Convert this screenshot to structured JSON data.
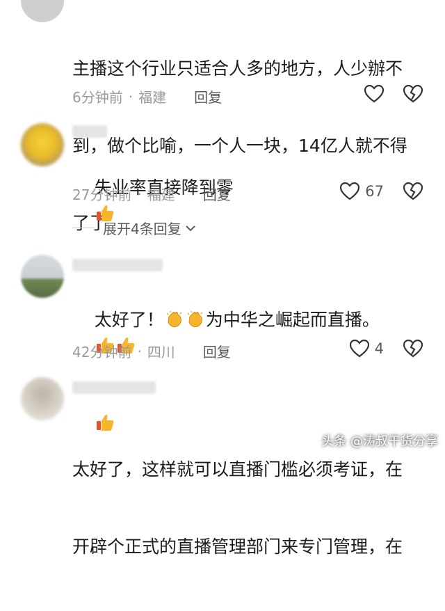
{
  "comments": [
    {
      "text_lines": [
        "主播这个行业只适合人多的地方，人少辦不",
        "到，做个比喻，一个人一块，14亿人就不得",
        "了了"
      ],
      "time": "6分钟前",
      "location": "福建",
      "reply_label": "回复",
      "likes": ""
    },
    {
      "text": "失业率直接降到零",
      "time": "27分钟前",
      "location": "福建",
      "reply_label": "回复",
      "likes": "67"
    },
    {
      "text_a": "太好了！",
      "text_b": "为中华之崛起而直播。",
      "time": "42分钟前",
      "location": "四川",
      "reply_label": "回复",
      "likes": "4"
    },
    {
      "text_lines": [
        "太好了，这样就可以直播门槛必须考证，在",
        "开辟个正式的直播管理部门来专门管理，在"
      ]
    }
  ],
  "expand_label": "展开4条回复",
  "separator": "·",
  "watermark": "头条 @涛叔干货分享",
  "icons": [
    "heart-outline-icon",
    "broken-heart-icon",
    "thumbs-up-emoji",
    "clapping-hands-emoji",
    "chevron-down-icon"
  ],
  "colors": {
    "text": "#1b1b1b",
    "meta": "#9a9a9a",
    "reply": "#5a5a5a",
    "icon": "#333333"
  }
}
